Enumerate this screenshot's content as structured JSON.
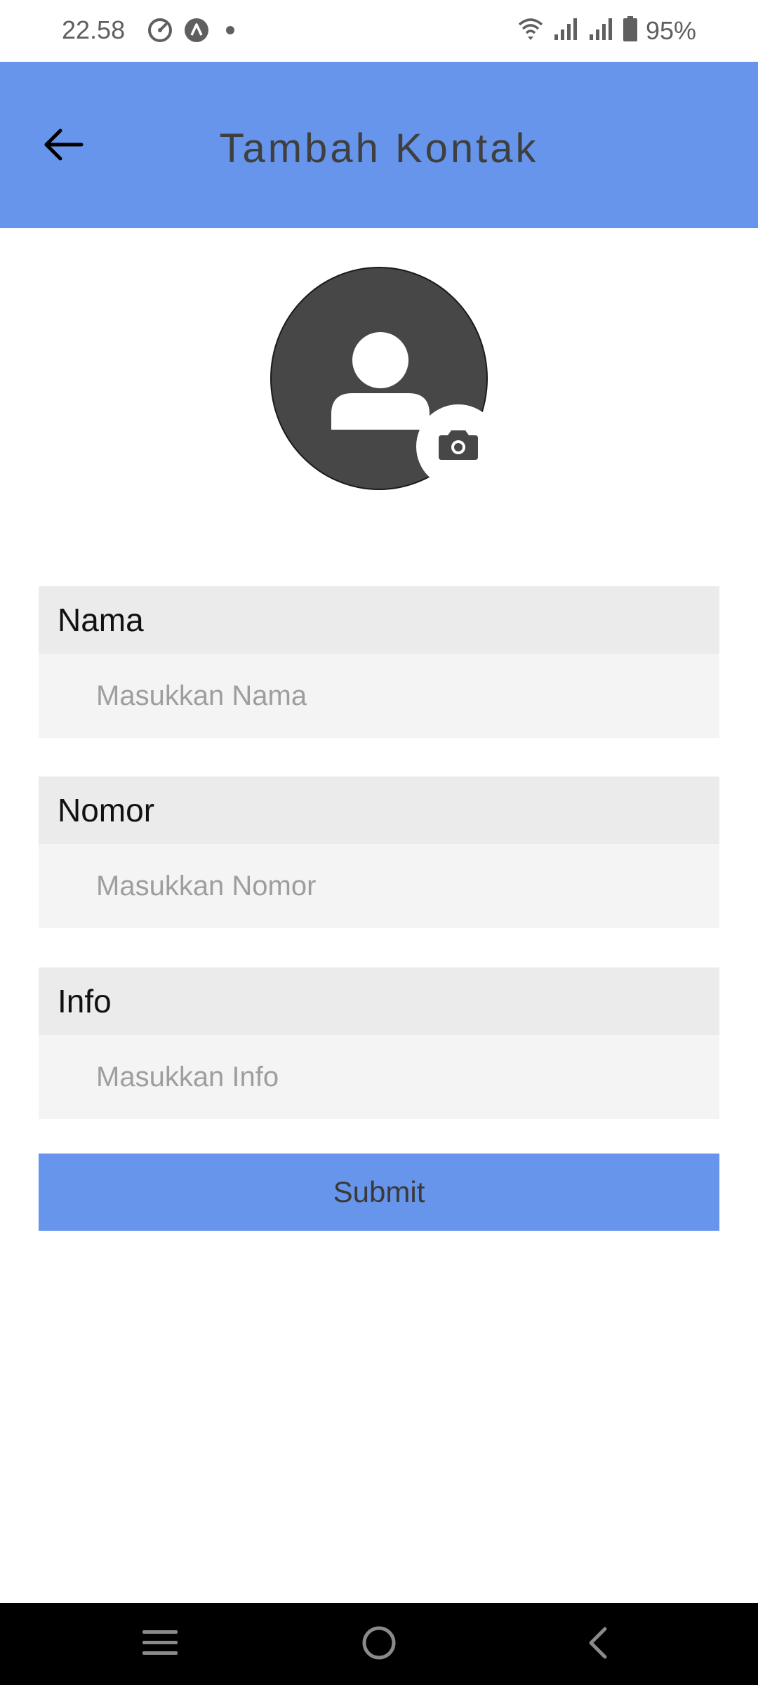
{
  "status_bar": {
    "time": "22.58",
    "battery": "95%",
    "icons": [
      "speedometer-icon",
      "a-circle-icon",
      "dot-icon",
      "wifi-icon",
      "signal-icon",
      "signal-icon",
      "battery-icon"
    ]
  },
  "app_bar": {
    "title": "Tambah Kontak",
    "back_icon": "arrow-left-icon",
    "background": "#6695eb"
  },
  "avatar": {
    "icon": "person-icon",
    "camera_icon": "camera-icon"
  },
  "form": {
    "fields": [
      {
        "label": "Nama",
        "placeholder": "Masukkan Nama",
        "value": ""
      },
      {
        "label": "Nomor",
        "placeholder": "Masukkan Nomor",
        "value": ""
      },
      {
        "label": "Info",
        "placeholder": "Masukkan Info",
        "value": ""
      }
    ],
    "submit_label": "Submit"
  },
  "nav_bar": {
    "items": [
      "menu-icon",
      "home-icon",
      "back-icon"
    ]
  }
}
